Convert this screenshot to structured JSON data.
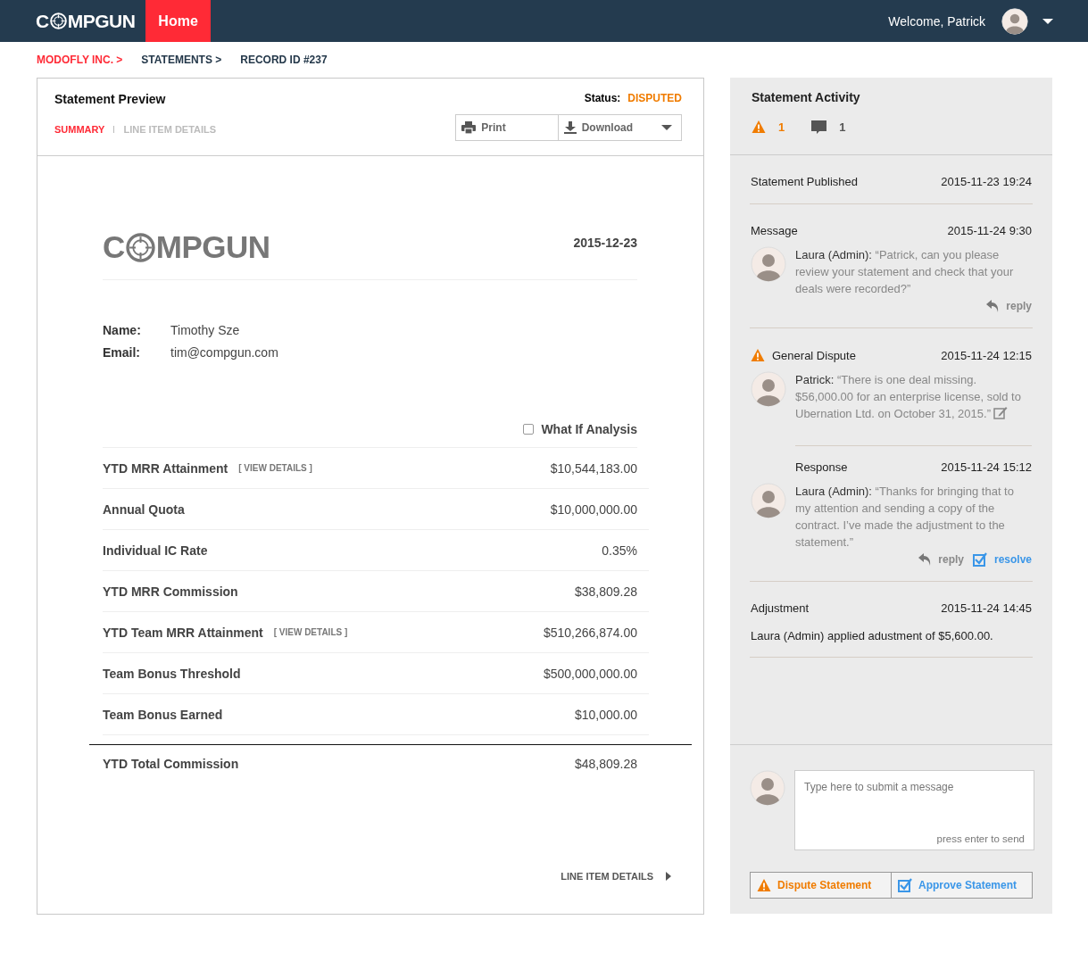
{
  "nav": {
    "logo": {
      "lead": "C",
      "tail": "MPGUN"
    },
    "items": [
      {
        "label": "Home",
        "selected": true
      }
    ],
    "welcome": "Welcome, Patrick"
  },
  "breadcrumbs": [
    {
      "label": "MODOFLY INC. >",
      "highlighted": true
    },
    {
      "label": "STATEMENTS >",
      "highlighted": false
    },
    {
      "label": "RECORD ID #237",
      "highlighted": false
    }
  ],
  "preview": {
    "title": "Statement Preview",
    "status_label": "Status:",
    "status": "DISPUTED",
    "tabs": [
      {
        "label": "SUMMARY",
        "selected": true
      },
      {
        "label": "LINE ITEM DETAILS",
        "selected": false
      }
    ],
    "print": "Print",
    "download": "Download",
    "document": {
      "logo": {
        "lead": "C",
        "tail": "MPGUN"
      },
      "date": "2015-12-23",
      "fields": [
        {
          "label": "Name:",
          "value": "Timothy Sze"
        },
        {
          "label": "Email:",
          "value": "tim@compgun.com"
        }
      ],
      "what_if": {
        "label": "What If Analysis",
        "checked": false
      },
      "rows": [
        {
          "label": "YTD MRR Attainment",
          "link": "[ VIEW DETAILS ]",
          "value": "$10,544,183.00"
        },
        {
          "label": "Annual Quota",
          "value": "$10,000,000.00"
        },
        {
          "label": "Individual IC Rate",
          "value": "0.35%"
        },
        {
          "label": "YTD MRR Commission",
          "value": "$38,809.28"
        },
        {
          "label": "YTD Team MRR Attainment",
          "link": "[ VIEW DETAILS ]",
          "value": "$510,266,874.00"
        },
        {
          "label": "Team Bonus Threshold",
          "value": "$500,000,000.00"
        },
        {
          "label": "Team Bonus Earned",
          "value": "$10,000.00"
        }
      ],
      "total": {
        "label": "YTD Total Commission",
        "value": "$48,809.28"
      },
      "footer_link": "LINE ITEM DETAILS"
    }
  },
  "activity": {
    "title": "Statement Activity",
    "counts": [
      {
        "kind": "dispute",
        "count": "1"
      },
      {
        "kind": "comment",
        "count": "1"
      }
    ],
    "events": [
      {
        "kind": "published",
        "title": "Statement Published",
        "time": "2015-11-23 19:24"
      },
      {
        "kind": "message",
        "title": "Message",
        "time": "2015-11-24 9:30",
        "author": "Laura (Admin):",
        "text": " “Patrick, can you please review your statement and check that your deals were recorded?”",
        "actions": [
          {
            "kind": "reply",
            "label": "reply"
          }
        ]
      },
      {
        "kind": "dispute",
        "title": "General Dispute",
        "time": "2015-11-24 12:15",
        "author": "Patrick:",
        "text": " “There is one deal missing. $56,000.00 for an enterprise license, sold to Ubernation Ltd. on October 31, 2015.”",
        "editable": true,
        "response": {
          "title": "Response",
          "time": "2015-11-24 15:12",
          "author": "Laura (Admin):",
          "text": " “Thanks for bringing that to my attention and sending a copy of the contract.  I’ve made the adjustment to the statement.”",
          "actions": [
            {
              "kind": "reply",
              "label": "reply"
            },
            {
              "kind": "resolve",
              "label": "resolve"
            }
          ]
        }
      },
      {
        "kind": "adjustment",
        "title": "Adjustment",
        "time": "2015-11-24 14:45",
        "text": "Laura (Admin) applied adustment of $5,600.00."
      }
    ],
    "composer": {
      "placeholder": "Type here to submit a message",
      "hint": "press enter to send"
    },
    "actions": [
      {
        "kind": "dispute",
        "label": "Dispute Statement"
      },
      {
        "kind": "approve",
        "label": "Approve Statement"
      }
    ]
  }
}
